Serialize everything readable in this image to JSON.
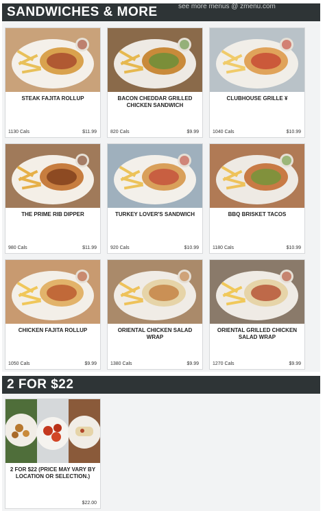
{
  "watermark": "see more menus @ zmenu.com",
  "sections": [
    {
      "title": "SANDWICHES & MORE",
      "items": [
        {
          "name": "STEAK FAJITA ROLLUP",
          "cals": "1130 Cals",
          "price": "$11.99"
        },
        {
          "name": "BACON CHEDDAR GRILLED CHICKEN SANDWICH",
          "cals": "820 Cals",
          "price": "$9.99"
        },
        {
          "name": "CLUBHOUSE GRILLE ¥",
          "cals": "1040 Cals",
          "price": "$10.99"
        },
        {
          "name": "THE PRIME RIB DIPPER",
          "cals": "980 Cals",
          "price": "$11.99"
        },
        {
          "name": "TURKEY LOVER'S SANDWICH",
          "cals": "920 Cals",
          "price": "$10.99"
        },
        {
          "name": "BBQ BRISKET TACOS",
          "cals": "1180 Cals",
          "price": "$10.99"
        },
        {
          "name": "CHICKEN FAJITA ROLLUP",
          "cals": "1050 Cals",
          "price": "$9.99"
        },
        {
          "name": "ORIENTAL CHICKEN SALAD WRAP",
          "cals": "1380 Cals",
          "price": "$9.99"
        },
        {
          "name": "ORIENTAL GRILLED CHICKEN SALAD WRAP",
          "cals": "1270 Cals",
          "price": "$9.99"
        }
      ]
    },
    {
      "title": "2 FOR $22",
      "items": [
        {
          "name": "2 FOR $22 (PRICE MAY VARY BY LOCATION OR SELECTION.)",
          "cals": "",
          "price": "$22.00"
        }
      ]
    }
  ],
  "colors": {
    "header_bg": "#2e3436",
    "panel_bg": "#f2f3f4",
    "card_border": "#d6d8da"
  }
}
